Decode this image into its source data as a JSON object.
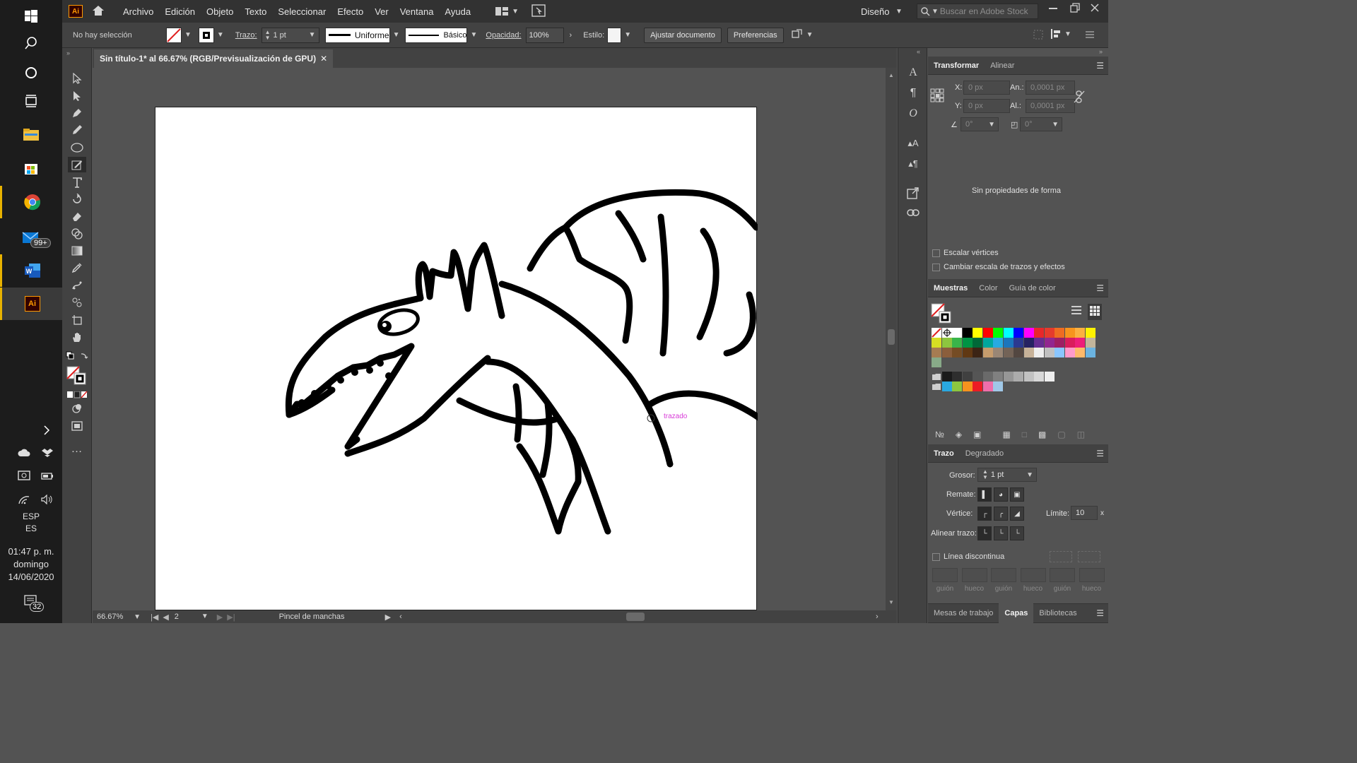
{
  "app": {
    "logo": "Ai",
    "workspace": "Diseño",
    "search_placeholder": "Buscar en Adobe Stock"
  },
  "menu": [
    "Archivo",
    "Edición",
    "Objeto",
    "Texto",
    "Seleccionar",
    "Efecto",
    "Ver",
    "Ventana",
    "Ayuda"
  ],
  "control": {
    "selection": "No hay selección",
    "stroke_label": "Trazo:",
    "stroke_value": "1 pt",
    "profile": "Uniforme",
    "brush": "Básico",
    "opacity_label": "Opacidad:",
    "opacity_value": "100%",
    "style_label": "Estilo:",
    "fit_button": "Ajustar documento",
    "prefs_button": "Preferencias"
  },
  "document": {
    "tab_title": "Sin título-1* al 66.67% (RGB/Previsualización de GPU)",
    "hint": "trazado"
  },
  "status": {
    "zoom": "66.67%",
    "artboard": "2",
    "tool": "Pincel de manchas"
  },
  "transform": {
    "tabs": [
      "Transformar",
      "Alinear"
    ],
    "x_label": "X:",
    "x_value": "0 px",
    "y_label": "Y:",
    "y_value": "0 px",
    "w_label": "An.:",
    "w_value": "0,0001 px",
    "h_label": "Al.:",
    "h_value": "0,0001 px",
    "angle_value": "0°",
    "shear_value": "0°",
    "no_props": "Sin propiedades de forma",
    "scale_corners": "Escalar vértices",
    "scale_strokes": "Cambiar escala de trazos y efectos"
  },
  "swatches": {
    "tabs": [
      "Muestras",
      "Color",
      "Guía de color"
    ]
  },
  "stroke_panel": {
    "tabs": [
      "Trazo",
      "Degradado"
    ],
    "weight_label": "Grosor:",
    "weight_value": "1 pt",
    "cap_label": "Remate:",
    "corner_label": "Vértice:",
    "limit_label": "Límite:",
    "limit_value": "10",
    "align_label": "Alinear trazo:",
    "dashed_label": "Línea discontinua",
    "dash_labels": [
      "guión",
      "hueco",
      "guión",
      "hueco",
      "guión",
      "hueco"
    ]
  },
  "bottom_tabs": [
    "Mesas de trabajo",
    "Capas",
    "Bibliotecas"
  ],
  "taskbar": {
    "mail_badge": "99+",
    "lang1": "ESP",
    "lang2": "ES",
    "time": "01:47 p. m.",
    "day": "domingo",
    "date": "14/06/2020",
    "notif_count": "32"
  },
  "colors": {
    "accent_yellow": "#e8b200",
    "ai_orange": "#ff9a00",
    "ai_bg": "#330000",
    "smart_guide": "#d83bd8"
  }
}
